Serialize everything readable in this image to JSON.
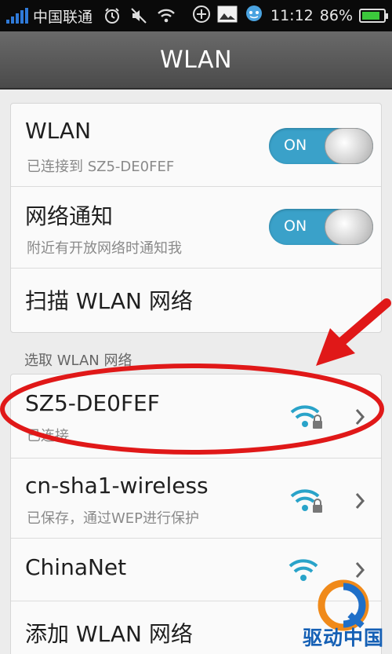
{
  "status_bar": {
    "carrier": "中国联通",
    "time": "11:12",
    "battery_percent": "86%",
    "battery_level": 0.86,
    "icons": [
      "signal-icon",
      "alarm-icon",
      "mute-icon",
      "wifi-icon",
      "add-circle-icon",
      "image-icon",
      "chat-icon",
      "battery-icon"
    ]
  },
  "header": {
    "title": "WLAN"
  },
  "settings": {
    "wlan": {
      "title": "WLAN",
      "subtitle": "已连接到 SZ5-DE0FEF",
      "toggle_label": "ON",
      "enabled": true
    },
    "network_notify": {
      "title": "网络通知",
      "subtitle": "附近有开放网络时通知我",
      "toggle_label": "ON",
      "enabled": true
    },
    "scan": {
      "title": "扫描 WLAN 网络"
    }
  },
  "section_label": "选取 WLAN 网络",
  "networks": [
    {
      "name": "SZ5-DE0FEF",
      "status": "已连接",
      "secured": true
    },
    {
      "name": "cn-sha1-wireless",
      "status": "已保存，通过WEP进行保护",
      "secured": true
    },
    {
      "name": "ChinaNet",
      "status": "",
      "secured": false
    }
  ],
  "add_network": {
    "title": "添加 WLAN 网络"
  },
  "watermark": {
    "text": "驱动中国"
  },
  "colors": {
    "accent": "#3aa1c9",
    "wifi": "#29a3c9",
    "annotation": "#e01818"
  }
}
